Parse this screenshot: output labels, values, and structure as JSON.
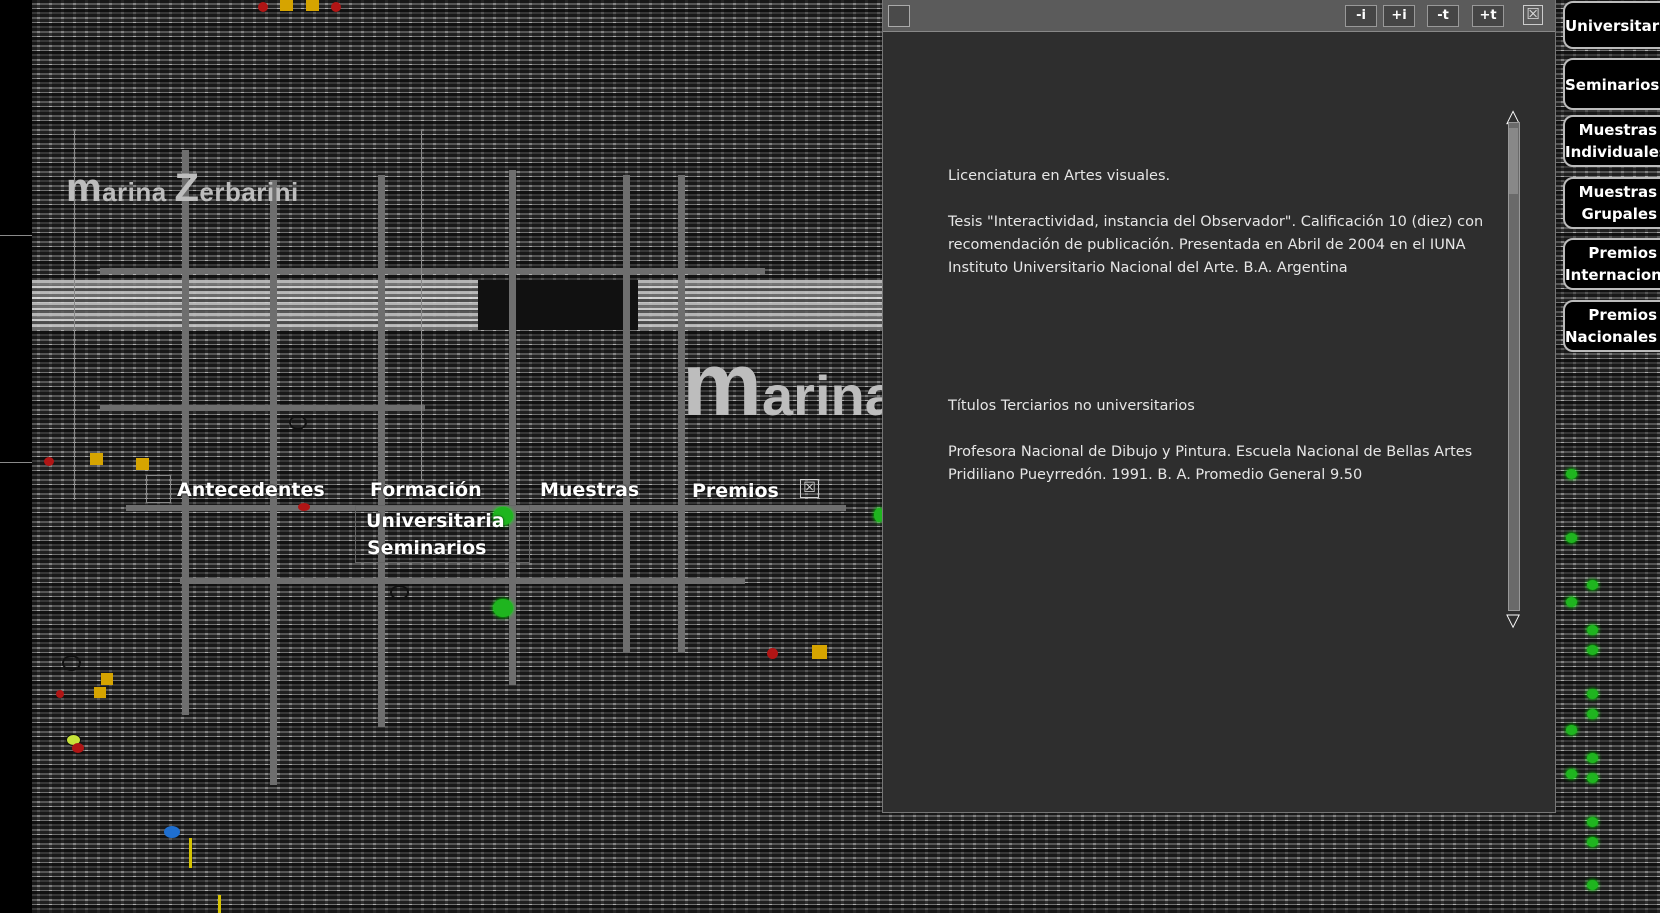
{
  "logo": {
    "small_cap1": "m",
    "small_rest1": "arina ",
    "small_cap2": "Z",
    "small_rest2": "erbarini",
    "big_cap": "m",
    "big_rest": "arina"
  },
  "nav": {
    "antecedentes": "Antecedentes",
    "formacion": "Formación",
    "muestras": "Muestras",
    "premios": "Premios",
    "close_glyph": "☒",
    "sub_universitaria": "Universitaria",
    "sub_seminarios": "Seminarios"
  },
  "panel": {
    "buttons": [
      "-i",
      "+i",
      "-t",
      "+t"
    ],
    "close_glyph": "☒",
    "paragraphs": [
      "Licenciatura en Artes visuales.",
      "Tesis \"Interactividad, instancia del Observador\". Calificación 10 (diez) con recomendación de publicación. Presentada en Abril de 2004 en el IUNA Instituto Universitario Nacional del Arte. B.A. Argentina",
      "Títulos Terciarios no universitarios",
      "Profesora Nacional de Dibujo y Pintura. Escuela Nacional de Bellas Artes Pridiliano Pueyrredón. 1991. B. A. Promedio General 9.50"
    ],
    "scroll_up": "△",
    "scroll_down": "▽"
  },
  "side_tabs": [
    [
      "Universitaria"
    ],
    [
      "Seminarios"
    ],
    [
      "Muestras",
      "Individuales"
    ],
    [
      "Muestras",
      "Grupales"
    ],
    [
      "Premios",
      "Internacionales"
    ],
    [
      "Premios",
      "Nacionales"
    ]
  ]
}
